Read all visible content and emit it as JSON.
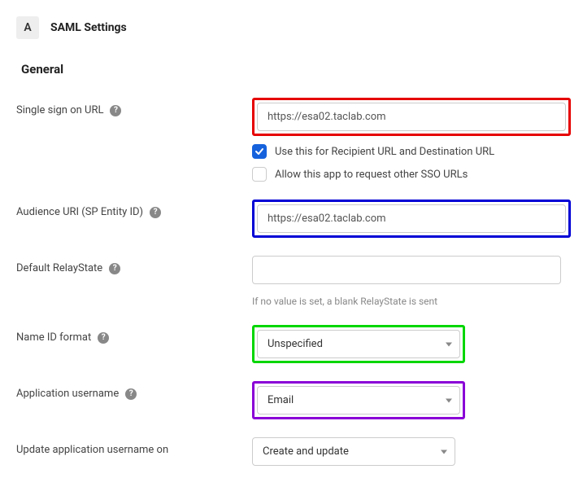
{
  "header": {
    "badge": "A",
    "title": "SAML Settings"
  },
  "section": {
    "title": "General"
  },
  "fields": {
    "sso_url": {
      "label": "Single sign on URL",
      "value": "https://esa02.taclab.com",
      "checkbox_recipient": "Use this for Recipient URL and Destination URL",
      "checkbox_allow": "Allow this app to request other SSO URLs"
    },
    "audience_uri": {
      "label": "Audience URI (SP Entity ID)",
      "value": "https://esa02.taclab.com"
    },
    "relay_state": {
      "label": "Default RelayState",
      "value": "",
      "hint": "If no value is set, a blank RelayState is sent"
    },
    "name_id": {
      "label": "Name ID format",
      "value": "Unspecified"
    },
    "app_username": {
      "label": "Application username",
      "value": "Email"
    },
    "update_on": {
      "label": "Update application username on",
      "value": "Create and update"
    }
  }
}
